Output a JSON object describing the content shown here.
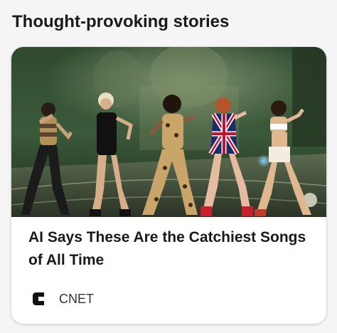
{
  "section": {
    "title": "Thought-provoking stories"
  },
  "card": {
    "headline": "AI Says These Are the Catchiest Songs of All Time",
    "image_subject": "five female pop singers performing on stage with microphones",
    "source": {
      "name": "CNET",
      "logo_icon": "cnet-logo-icon"
    }
  },
  "colors": {
    "page_background": "#f5f5f5",
    "card_background": "#ffffff",
    "text_primary": "#1a1a1a",
    "text_secondary": "#333333"
  }
}
